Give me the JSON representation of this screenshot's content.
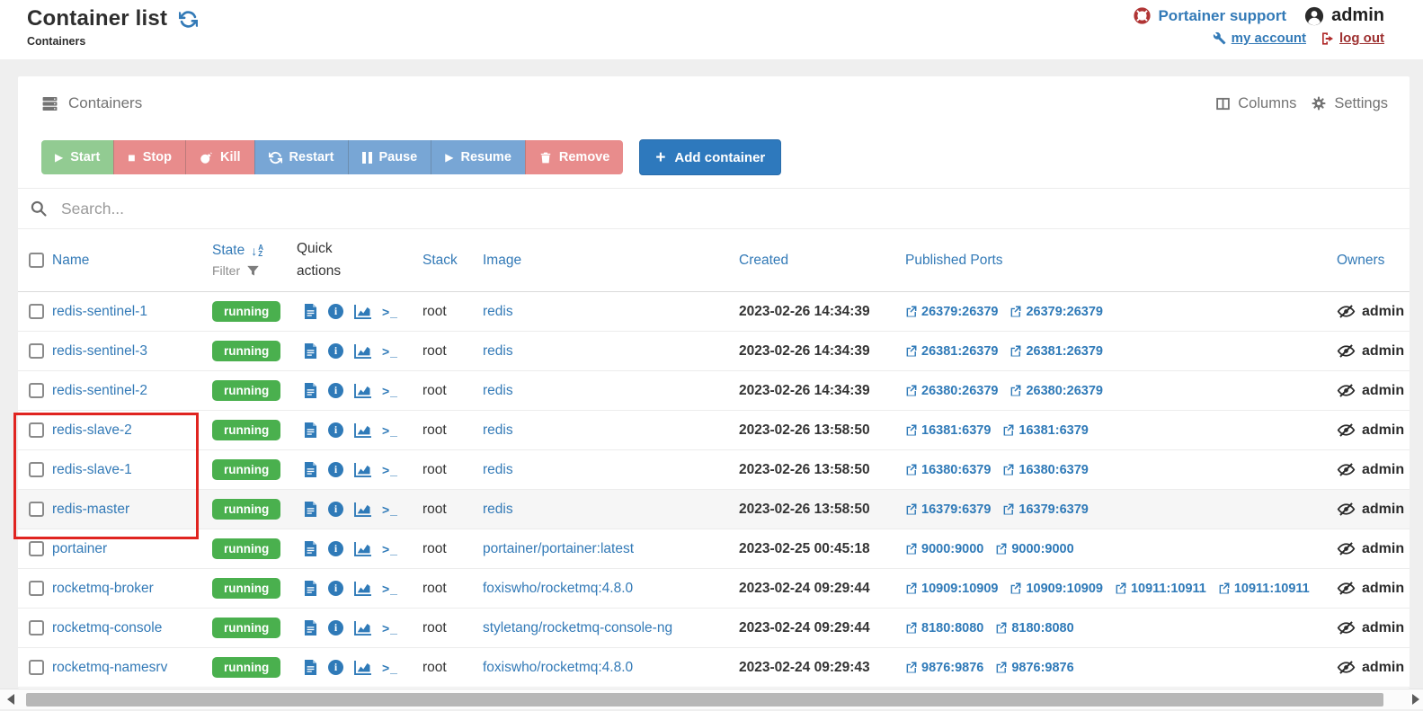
{
  "page": {
    "title": "Container list",
    "subtitle": "Containers"
  },
  "topbar": {
    "support": "Portainer support",
    "user": "admin",
    "my_account": "my account",
    "logout": "log out"
  },
  "panel": {
    "title": "Containers",
    "columns": "Columns",
    "settings": "Settings"
  },
  "toolbar": {
    "group_buttons": [
      {
        "label": "Start",
        "variant": "green",
        "icon": "play"
      },
      {
        "label": "Stop",
        "variant": "red",
        "icon": "stop"
      },
      {
        "label": "Kill",
        "variant": "red",
        "icon": "bomb"
      },
      {
        "label": "Restart",
        "variant": "blue",
        "icon": "refresh"
      },
      {
        "label": "Pause",
        "variant": "blue",
        "icon": "pause"
      },
      {
        "label": "Resume",
        "variant": "blue",
        "icon": "play"
      },
      {
        "label": "Remove",
        "variant": "red",
        "icon": "trash"
      }
    ],
    "add_button": {
      "label": "Add container"
    }
  },
  "search": {
    "placeholder": "Search..."
  },
  "table": {
    "headers": {
      "name": "Name",
      "state": "State",
      "filter": "Filter",
      "quick_actions": "Quick actions",
      "stack": "Stack",
      "image": "Image",
      "created": "Created",
      "ports": "Published Ports",
      "owners": "Owners"
    },
    "quick_action_icons": [
      "logs",
      "inspect",
      "stats",
      "console"
    ],
    "rows": [
      {
        "name": "redis-sentinel-1",
        "state": "running",
        "stack": "root",
        "image": "redis",
        "created": "2023-02-26 14:34:39",
        "ports": [
          "26379:26379",
          "26379:26379"
        ],
        "owner": "admin"
      },
      {
        "name": "redis-sentinel-3",
        "state": "running",
        "stack": "root",
        "image": "redis",
        "created": "2023-02-26 14:34:39",
        "ports": [
          "26381:26379",
          "26381:26379"
        ],
        "owner": "admin"
      },
      {
        "name": "redis-sentinel-2",
        "state": "running",
        "stack": "root",
        "image": "redis",
        "created": "2023-02-26 14:34:39",
        "ports": [
          "26380:26379",
          "26380:26379"
        ],
        "owner": "admin"
      },
      {
        "name": "redis-slave-2",
        "state": "running",
        "stack": "root",
        "image": "redis",
        "created": "2023-02-26 13:58:50",
        "ports": [
          "16381:6379",
          "16381:6379"
        ],
        "owner": "admin"
      },
      {
        "name": "redis-slave-1",
        "state": "running",
        "stack": "root",
        "image": "redis",
        "created": "2023-02-26 13:58:50",
        "ports": [
          "16380:6379",
          "16380:6379"
        ],
        "owner": "admin"
      },
      {
        "name": "redis-master",
        "state": "running",
        "stack": "root",
        "image": "redis",
        "created": "2023-02-26 13:58:50",
        "ports": [
          "16379:6379",
          "16379:6379"
        ],
        "owner": "admin"
      },
      {
        "name": "portainer",
        "state": "running",
        "stack": "root",
        "image": "portainer/portainer:latest",
        "created": "2023-02-25 00:45:18",
        "ports": [
          "9000:9000",
          "9000:9000"
        ],
        "owner": "admin"
      },
      {
        "name": "rocketmq-broker",
        "state": "running",
        "stack": "root",
        "image": "foxiswho/rocketmq:4.8.0",
        "created": "2023-02-24 09:29:44",
        "ports": [
          "10909:10909",
          "10909:10909",
          "10911:10911",
          "10911:10911"
        ],
        "owner": "admin"
      },
      {
        "name": "rocketmq-console",
        "state": "running",
        "stack": "root",
        "image": "styletang/rocketmq-console-ng",
        "created": "2023-02-24 09:29:44",
        "ports": [
          "8180:8080",
          "8180:8080"
        ],
        "owner": "admin"
      },
      {
        "name": "rocketmq-namesrv",
        "state": "running",
        "stack": "root",
        "image": "foxiswho/rocketmq:4.8.0",
        "created": "2023-02-24 09:29:43",
        "ports": [
          "9876:9876",
          "9876:9876"
        ],
        "owner": "admin"
      }
    ]
  },
  "colors": {
    "primary_blue": "#337ab7",
    "running_green": "#4ab04e",
    "button_green": "#92cb92",
    "button_red": "#e88c8c",
    "button_blue": "#78a6d5",
    "add_blue": "#2e79bd",
    "logout_red": "#9e3131",
    "annotation_red": "#e02420"
  }
}
